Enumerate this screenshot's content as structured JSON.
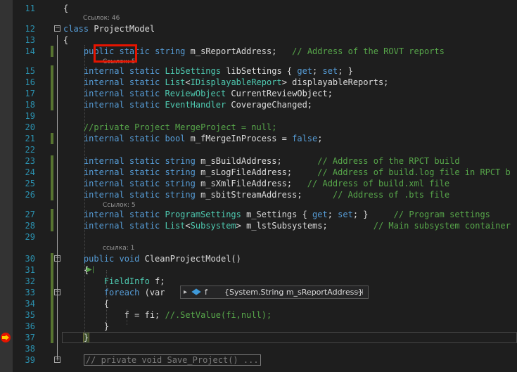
{
  "lines": [
    {
      "n": "11",
      "segs": [
        {
          "t": "{",
          "c": ""
        }
      ]
    },
    {
      "n": "12",
      "segs": [
        {
          "t": "class ",
          "c": "kw"
        },
        {
          "t": "ProjectModel",
          "c": ""
        }
      ]
    },
    {
      "n": "13",
      "segs": [
        {
          "t": "{",
          "c": ""
        }
      ]
    },
    {
      "n": "14",
      "segs": [
        {
          "t": "    public ",
          "c": "kw"
        },
        {
          "t": "static ",
          "c": "kw"
        },
        {
          "t": "string ",
          "c": "kw"
        },
        {
          "t": "m_sReportAddress;   ",
          "c": ""
        },
        {
          "t": "// Address of the ROVT reports",
          "c": "cm"
        }
      ]
    },
    {
      "n": "15",
      "segs": [
        {
          "t": "    internal ",
          "c": "kw"
        },
        {
          "t": "static ",
          "c": "kw"
        },
        {
          "t": "LibSettings ",
          "c": "ty"
        },
        {
          "t": "libSettings { ",
          "c": ""
        },
        {
          "t": "get",
          "c": "kw"
        },
        {
          "t": "; ",
          "c": ""
        },
        {
          "t": "set",
          "c": "kw"
        },
        {
          "t": "; }",
          "c": ""
        }
      ]
    },
    {
      "n": "16",
      "segs": [
        {
          "t": "    internal ",
          "c": "kw"
        },
        {
          "t": "static ",
          "c": "kw"
        },
        {
          "t": "List",
          "c": "ty"
        },
        {
          "t": "<",
          "c": ""
        },
        {
          "t": "IDisplayableReport",
          "c": "ty"
        },
        {
          "t": "> displayableReports;",
          "c": ""
        }
      ]
    },
    {
      "n": "17",
      "segs": [
        {
          "t": "    internal ",
          "c": "kw"
        },
        {
          "t": "static ",
          "c": "kw"
        },
        {
          "t": "ReviewObject ",
          "c": "ty"
        },
        {
          "t": "CurrentReviewObject;",
          "c": ""
        }
      ]
    },
    {
      "n": "18",
      "segs": [
        {
          "t": "    internal ",
          "c": "kw"
        },
        {
          "t": "static ",
          "c": "kw"
        },
        {
          "t": "EventHandler ",
          "c": "ty"
        },
        {
          "t": "CoverageChanged;",
          "c": ""
        }
      ]
    },
    {
      "n": "19",
      "segs": []
    },
    {
      "n": "20",
      "segs": [
        {
          "t": "    //private Project MergeProject = null;",
          "c": "cm"
        }
      ]
    },
    {
      "n": "21",
      "segs": [
        {
          "t": "    internal ",
          "c": "kw"
        },
        {
          "t": "static ",
          "c": "kw"
        },
        {
          "t": "bool ",
          "c": "kw"
        },
        {
          "t": "m_fMergeInProcess = ",
          "c": ""
        },
        {
          "t": "false",
          "c": "kw"
        },
        {
          "t": ";",
          "c": ""
        }
      ]
    },
    {
      "n": "22",
      "segs": []
    },
    {
      "n": "23",
      "segs": [
        {
          "t": "    internal ",
          "c": "kw"
        },
        {
          "t": "static ",
          "c": "kw"
        },
        {
          "t": "string ",
          "c": "kw"
        },
        {
          "t": "m_sBuildAddress;       ",
          "c": ""
        },
        {
          "t": "// Address of the RPCT build",
          "c": "cm"
        }
      ]
    },
    {
      "n": "24",
      "segs": [
        {
          "t": "    internal ",
          "c": "kw"
        },
        {
          "t": "static ",
          "c": "kw"
        },
        {
          "t": "string ",
          "c": "kw"
        },
        {
          "t": "m_sLogFileAddress;     ",
          "c": ""
        },
        {
          "t": "// Address of build.log file in RPCT b",
          "c": "cm"
        }
      ]
    },
    {
      "n": "25",
      "segs": [
        {
          "t": "    internal ",
          "c": "kw"
        },
        {
          "t": "static ",
          "c": "kw"
        },
        {
          "t": "string ",
          "c": "kw"
        },
        {
          "t": "m_sXmlFileAddress;   ",
          "c": ""
        },
        {
          "t": "// Address of build.xml file",
          "c": "cm"
        }
      ]
    },
    {
      "n": "26",
      "segs": [
        {
          "t": "    internal ",
          "c": "kw"
        },
        {
          "t": "static ",
          "c": "kw"
        },
        {
          "t": "string ",
          "c": "kw"
        },
        {
          "t": "m_sbitStreamAddress;      ",
          "c": ""
        },
        {
          "t": "// Address of .bts file",
          "c": "cm"
        }
      ]
    },
    {
      "n": "27",
      "segs": [
        {
          "t": "    internal ",
          "c": "kw"
        },
        {
          "t": "static ",
          "c": "kw"
        },
        {
          "t": "ProgramSettings ",
          "c": "ty"
        },
        {
          "t": "m_Settings { ",
          "c": ""
        },
        {
          "t": "get",
          "c": "kw"
        },
        {
          "t": "; ",
          "c": ""
        },
        {
          "t": "set",
          "c": "kw"
        },
        {
          "t": "; }     ",
          "c": ""
        },
        {
          "t": "// Program settings",
          "c": "cm"
        }
      ]
    },
    {
      "n": "28",
      "segs": [
        {
          "t": "    internal ",
          "c": "kw"
        },
        {
          "t": "static ",
          "c": "kw"
        },
        {
          "t": "List",
          "c": "ty"
        },
        {
          "t": "<",
          "c": ""
        },
        {
          "t": "Subsystem",
          "c": "ty"
        },
        {
          "t": "> m_lstSubsystems;         ",
          "c": ""
        },
        {
          "t": "// Main subsystem container",
          "c": "cm"
        }
      ]
    },
    {
      "n": "29",
      "segs": []
    },
    {
      "n": "30",
      "segs": [
        {
          "t": "    public ",
          "c": "kw"
        },
        {
          "t": "void ",
          "c": "kw"
        },
        {
          "t": "CleanProjectModel()",
          "c": ""
        }
      ]
    },
    {
      "n": "31",
      "segs": [
        {
          "t": "    {",
          "c": ""
        }
      ]
    },
    {
      "n": "32",
      "segs": [
        {
          "t": "        FieldInfo ",
          "c": "ty"
        },
        {
          "t": "f;",
          "c": ""
        }
      ]
    },
    {
      "n": "33",
      "segs": [
        {
          "t": "        foreach ",
          "c": "kw"
        },
        {
          "t": "(var",
          "c": ""
        }
      ]
    },
    {
      "n": "34",
      "segs": [
        {
          "t": "        {",
          "c": ""
        }
      ]
    },
    {
      "n": "35",
      "segs": [
        {
          "t": "            f = fi; ",
          "c": ""
        },
        {
          "t": "//.SetValue(fi,null);",
          "c": "cm"
        }
      ]
    },
    {
      "n": "36",
      "segs": [
        {
          "t": "        }",
          "c": ""
        }
      ]
    },
    {
      "n": "37",
      "segs": [
        {
          "t": "    ",
          "c": ""
        },
        {
          "t": "}",
          "c": "brace"
        }
      ]
    },
    {
      "n": "38",
      "segs": []
    },
    {
      "n": "39",
      "segs": [
        {
          "t": "    ",
          "c": ""
        },
        {
          "t": "// private void Save_Project() ...",
          "c": "collapsed"
        }
      ]
    }
  ],
  "refs": [
    {
      "id": "ref1",
      "label": "Ссылок: 46"
    },
    {
      "id": "ref2",
      "label": "Ссылок: 5"
    },
    {
      "id": "ref3",
      "label": "Ссылок: 5"
    },
    {
      "id": "ref4",
      "label": "ссылка: 1"
    }
  ],
  "tooltip": {
    "var": "f",
    "value": "{System.String m_sReportAddress}"
  },
  "colors": {
    "keyword": "#569cd6",
    "type": "#4ec9b0",
    "comment": "#57a64a",
    "linenum": "#2b91af"
  }
}
